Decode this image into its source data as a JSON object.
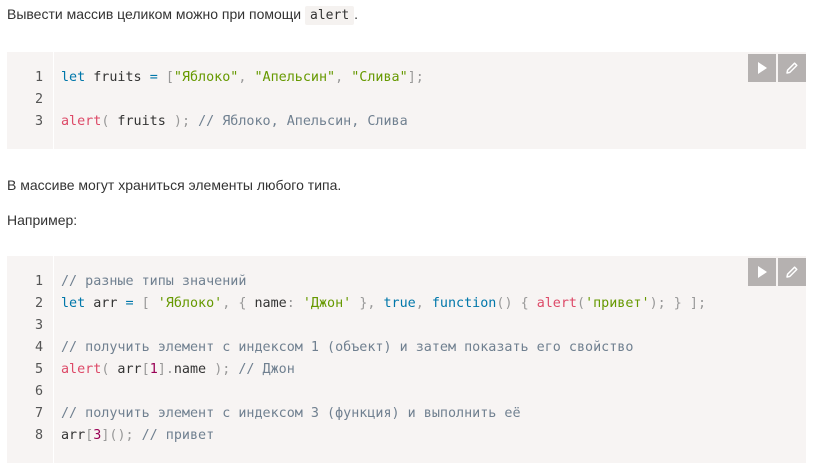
{
  "para1": {
    "text": "Вывести массив целиком можно при помощи",
    "code": "alert",
    "tail": "."
  },
  "block1": {
    "line_numbers": [
      "1",
      "2",
      "3"
    ],
    "lines": [
      [
        {
          "t": "let",
          "c": "kw"
        },
        {
          "t": " fruits "
        },
        {
          "t": "=",
          "c": "kw"
        },
        {
          "t": " "
        },
        {
          "t": "[",
          "c": "punc"
        },
        {
          "t": "\"Яблоко\"",
          "c": "str"
        },
        {
          "t": ",",
          "c": "punc"
        },
        {
          "t": " "
        },
        {
          "t": "\"Апельсин\"",
          "c": "str"
        },
        {
          "t": ",",
          "c": "punc"
        },
        {
          "t": " "
        },
        {
          "t": "\"Слива\"",
          "c": "str"
        },
        {
          "t": "]",
          "c": "punc"
        },
        {
          "t": ";",
          "c": "punc"
        }
      ],
      [],
      [
        {
          "t": "alert",
          "c": "fn"
        },
        {
          "t": "(",
          "c": "punc"
        },
        {
          "t": " fruits "
        },
        {
          "t": ")",
          "c": "punc"
        },
        {
          "t": ";",
          "c": "punc"
        },
        {
          "t": " "
        },
        {
          "t": "// Яблоко, Апельсин, Слива",
          "c": "com"
        }
      ]
    ]
  },
  "para2": {
    "text": "В массиве могут храниться элементы любого типа."
  },
  "para3": {
    "text": "Например:"
  },
  "block2": {
    "line_numbers": [
      "1",
      "2",
      "3",
      "4",
      "5",
      "6",
      "7",
      "8"
    ],
    "lines": [
      [
        {
          "t": "// разные типы значений",
          "c": "com"
        }
      ],
      [
        {
          "t": "let",
          "c": "kw"
        },
        {
          "t": " arr "
        },
        {
          "t": "=",
          "c": "kw"
        },
        {
          "t": " "
        },
        {
          "t": "[",
          "c": "punc"
        },
        {
          "t": " "
        },
        {
          "t": "'Яблоко'",
          "c": "str"
        },
        {
          "t": ",",
          "c": "punc"
        },
        {
          "t": " "
        },
        {
          "t": "{",
          "c": "punc"
        },
        {
          "t": " name"
        },
        {
          "t": ":",
          "c": "punc"
        },
        {
          "t": " "
        },
        {
          "t": "'Джон'",
          "c": "str"
        },
        {
          "t": " "
        },
        {
          "t": "}",
          "c": "punc"
        },
        {
          "t": ",",
          "c": "punc"
        },
        {
          "t": " "
        },
        {
          "t": "true",
          "c": "kw"
        },
        {
          "t": ",",
          "c": "punc"
        },
        {
          "t": " "
        },
        {
          "t": "function",
          "c": "kw"
        },
        {
          "t": "(",
          "c": "punc"
        },
        {
          "t": ")",
          "c": "punc"
        },
        {
          "t": " "
        },
        {
          "t": "{",
          "c": "punc"
        },
        {
          "t": " "
        },
        {
          "t": "alert",
          "c": "fn"
        },
        {
          "t": "(",
          "c": "punc"
        },
        {
          "t": "'привет'",
          "c": "str"
        },
        {
          "t": ")",
          "c": "punc"
        },
        {
          "t": ";",
          "c": "punc"
        },
        {
          "t": " "
        },
        {
          "t": "}",
          "c": "punc"
        },
        {
          "t": " "
        },
        {
          "t": "]",
          "c": "punc"
        },
        {
          "t": ";",
          "c": "punc"
        }
      ],
      [],
      [
        {
          "t": "// получить элемент с индексом 1 (объект) и затем показать его свойство",
          "c": "com"
        }
      ],
      [
        {
          "t": "alert",
          "c": "fn"
        },
        {
          "t": "(",
          "c": "punc"
        },
        {
          "t": " arr"
        },
        {
          "t": "[",
          "c": "punc"
        },
        {
          "t": "1",
          "c": "num"
        },
        {
          "t": "]",
          "c": "punc"
        },
        {
          "t": ".",
          "c": "punc"
        },
        {
          "t": "name "
        },
        {
          "t": ")",
          "c": "punc"
        },
        {
          "t": ";",
          "c": "punc"
        },
        {
          "t": " "
        },
        {
          "t": "// Джон",
          "c": "com"
        }
      ],
      [],
      [
        {
          "t": "// получить элемент с индексом 3 (функция) и выполнить её",
          "c": "com"
        }
      ],
      [
        {
          "t": "arr"
        },
        {
          "t": "[",
          "c": "punc"
        },
        {
          "t": "3",
          "c": "num"
        },
        {
          "t": "]",
          "c": "punc"
        },
        {
          "t": "(",
          "c": "punc"
        },
        {
          "t": ")",
          "c": "punc"
        },
        {
          "t": ";",
          "c": "punc"
        },
        {
          "t": " "
        },
        {
          "t": "// привет",
          "c": "com"
        }
      ]
    ]
  },
  "toolbar": {
    "run_icon": "play-icon",
    "edit_icon": "pencil-icon"
  },
  "colors": {
    "code_bg": "#f7f4f3",
    "keyword": "#0077aa",
    "string": "#669900",
    "function": "#dd4a68",
    "comment": "#708090",
    "button_bg": "#b5b1b0"
  }
}
